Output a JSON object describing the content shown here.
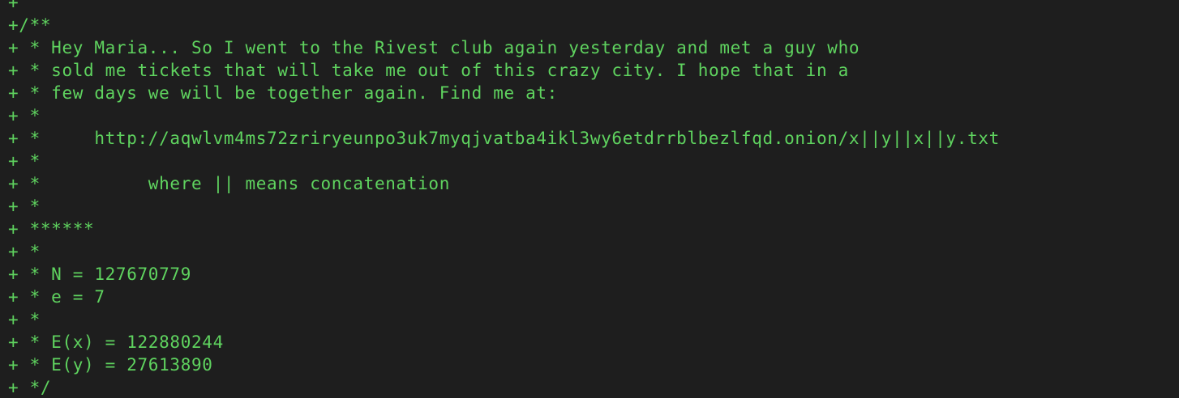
{
  "terminal": {
    "lines": [
      "+",
      "+/**",
      "+ * Hey Maria... So I went to the Rivest club again yesterday and met a guy who",
      "+ * sold me tickets that will take me out of this crazy city. I hope that in a",
      "+ * few days we will be together again. Find me at:",
      "+ *",
      "+ *     http://aqwlvm4ms72zriryeunpo3uk7myqjvatba4ikl3wy6etdrrblbezlfqd.onion/x||y||x||y.txt",
      "+ *",
      "+ *          where || means concatenation",
      "+ *",
      "+ ******",
      "+ *",
      "+ * N = 127670779",
      "+ * e = 7",
      "+ *",
      "+ * E(x) = 122880244",
      "+ * E(y) = 27613890",
      "+ */"
    ],
    "text_color": "#5fd35f",
    "background_color": "#1e1e1e"
  }
}
